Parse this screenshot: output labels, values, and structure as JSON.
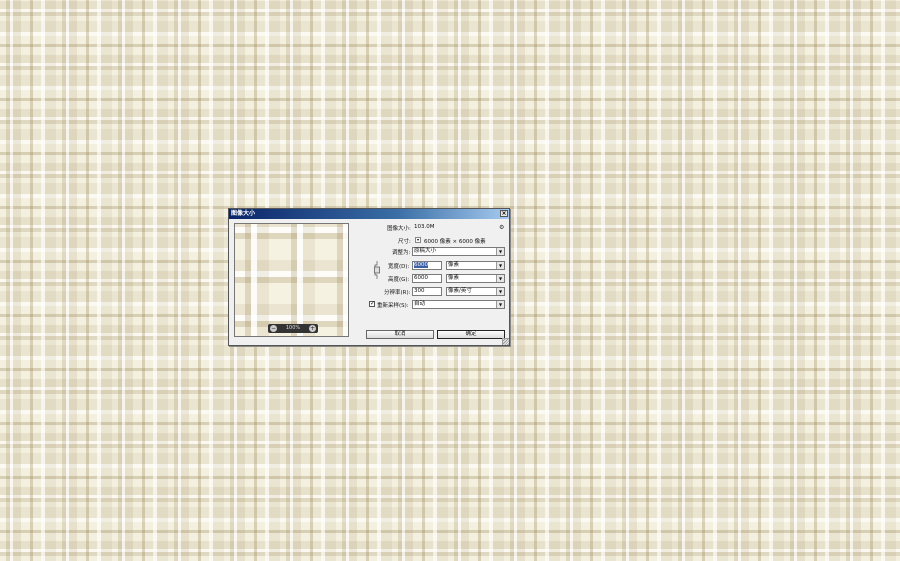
{
  "dialog": {
    "title": "图像大小",
    "close_glyph": "×"
  },
  "info": {
    "image_size_label": "图像大小:",
    "image_size_value": "103.0M",
    "dimensions_label": "尺寸:",
    "dimensions_value": "6000 像素  ×  6000 像素",
    "dimensions_toggle_glyph": "▾"
  },
  "fit_to": {
    "label": "调整为:",
    "value": "原稿大小"
  },
  "width": {
    "label": "宽度(D):",
    "value": "6000",
    "unit": "像素"
  },
  "height": {
    "label": "高度(G):",
    "value": "6000",
    "unit": "像素"
  },
  "resolution": {
    "label": "分辨率(R):",
    "value": "300",
    "unit": "像素/英寸"
  },
  "resample": {
    "label": "重新采样(S):",
    "checked": true,
    "check_glyph": "✓",
    "value": "自动"
  },
  "preview": {
    "zoom_label": "100%",
    "zoom_out_glyph": "−",
    "zoom_in_glyph": "+"
  },
  "buttons": {
    "cancel": "取消",
    "ok": "确定"
  },
  "icons": {
    "gear": "⚙",
    "dropdown_arrow": "▼"
  },
  "colors": {
    "titlebar_start": "#0a246a",
    "titlebar_end": "#a6caf0",
    "selection": "#3a5fa8",
    "dialog_bg": "#f0f0f0"
  }
}
